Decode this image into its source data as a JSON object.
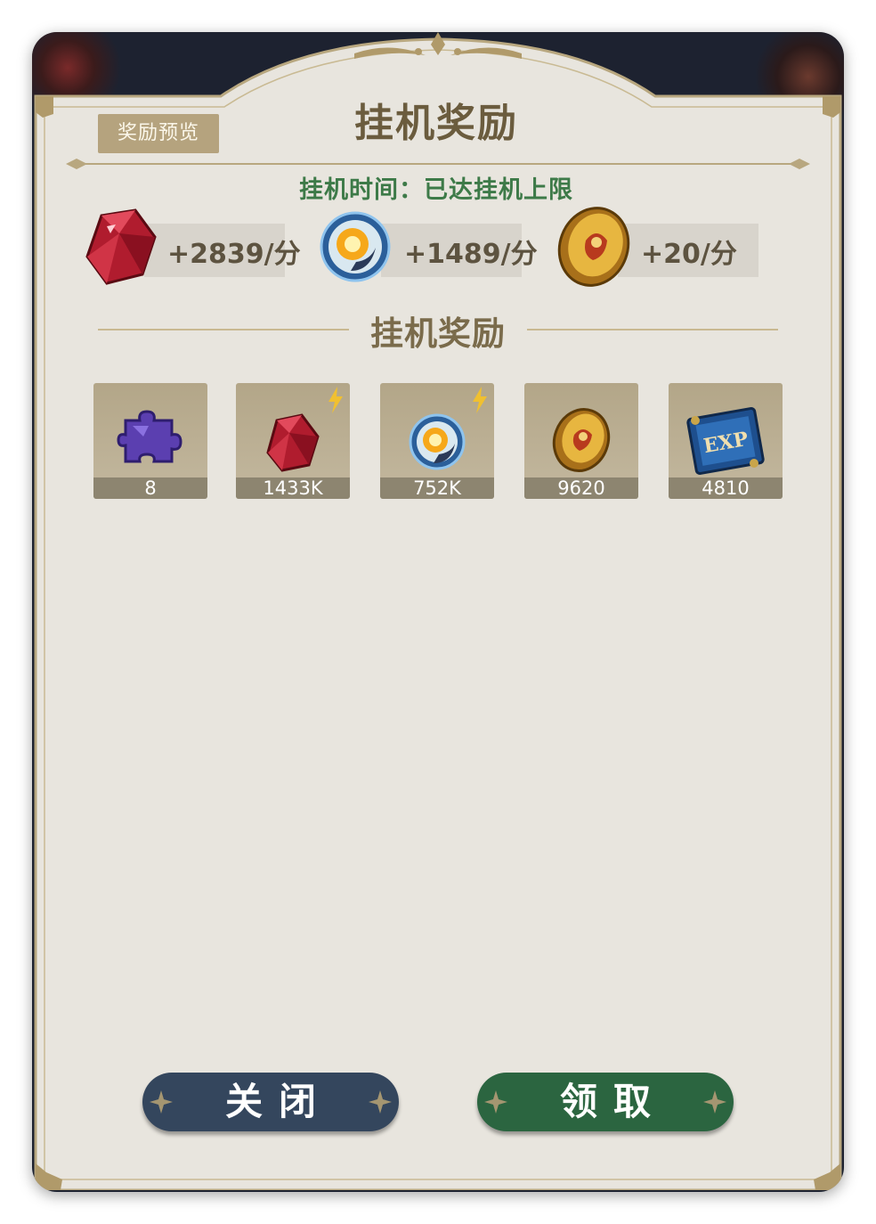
{
  "dialog": {
    "title": "挂机奖励",
    "preview_button_label": "奖励预览",
    "idle_time_text": "挂机时间：已达挂机上限",
    "section_title": "挂机奖励"
  },
  "rates": [
    {
      "icon": "ruby-gem-icon",
      "text": "+2839/分"
    },
    {
      "icon": "energy-orb-icon",
      "text": "+1489/分"
    },
    {
      "icon": "gold-coin-icon",
      "text": "+20/分"
    }
  ],
  "rewards": [
    {
      "icon": "puzzle-piece-icon",
      "count": "8",
      "boosted": false
    },
    {
      "icon": "ruby-gem-icon",
      "count": "1433K",
      "boosted": true
    },
    {
      "icon": "energy-orb-icon",
      "count": "752K",
      "boosted": true
    },
    {
      "icon": "gold-coin-icon",
      "count": "9620",
      "boosted": false
    },
    {
      "icon": "exp-scroll-icon",
      "count": "4810",
      "boosted": false
    }
  ],
  "reward_icon_text": {
    "exp_scroll": "EXP"
  },
  "buttons": {
    "close_label": "关闭",
    "claim_label": "领取"
  },
  "colors": {
    "panel": "#e8e5de",
    "accent_gold": "#b5a37e",
    "title_text": "#6b5c3e",
    "idle_time_text": "#3d7a48",
    "close_button": "#34465d",
    "claim_button": "#2b6540"
  }
}
